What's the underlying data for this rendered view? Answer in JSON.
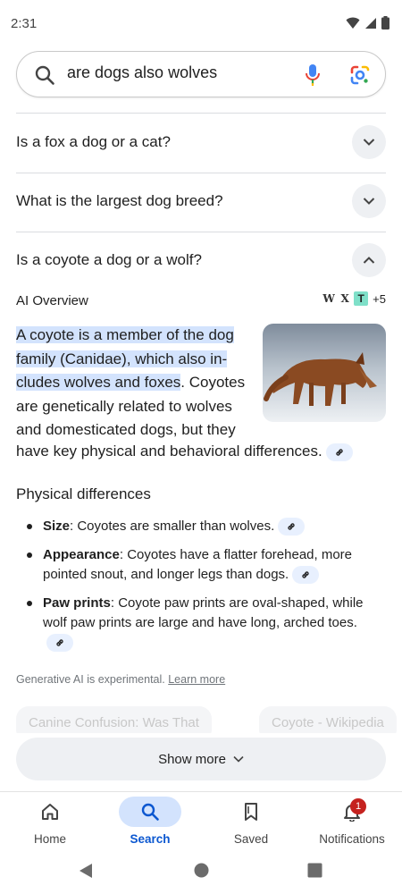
{
  "status_bar": {
    "time": "2:31"
  },
  "search": {
    "query": "are dogs also wolves"
  },
  "related_questions": [
    {
      "text": "Is a fox a dog or a cat?",
      "expanded": false
    },
    {
      "text": "What is the largest dog breed?",
      "expanded": false
    },
    {
      "text": "Is a coyote a dog or a wolf?",
      "expanded": true
    }
  ],
  "ai_overview": {
    "label": "AI Overview",
    "source_count": "+5",
    "highlight_lines": [
      "A coyote is a member of the dog",
      "family (Canidae), which also in-",
      "cludes wolves and foxes"
    ],
    "text_tail_line1": ". Coyotes",
    "text_short_lines": [
      "are genetically related to wolves",
      "and domesticated dogs, but they"
    ],
    "text_full_line": "have key physical and behavioral differences.",
    "section_heading": "Physical differences",
    "bullets": [
      {
        "term": "Size",
        "text": ": Coyotes are smaller than wolves."
      },
      {
        "term": "Appearance",
        "text": ": Coyotes have a flatter forehead, more pointed snout, and longer legs than dogs."
      },
      {
        "term": "Paw prints",
        "text": ": Coyote paw prints are oval-shaped, while wolf paw prints are large and have long, arched toes."
      }
    ],
    "disclaimer": "Generative AI is experimental.",
    "learn_more": "Learn more",
    "source_cards": [
      "Canine Confusion: Was That",
      "Coyote - Wikipedia"
    ]
  },
  "show_more_label": "Show more",
  "bottom_nav": {
    "items": [
      {
        "label": "Home",
        "icon": "home-icon"
      },
      {
        "label": "Search",
        "icon": "search-icon",
        "active": true
      },
      {
        "label": "Saved",
        "icon": "bookmark-icon"
      },
      {
        "label": "Notifications",
        "icon": "bell-icon"
      }
    ],
    "notification_count": "1"
  },
  "colors": {
    "accent": "#0b57d0",
    "highlight": "#d3e3fd",
    "badge": "#c5221f",
    "chip": "#e8f0fe"
  }
}
